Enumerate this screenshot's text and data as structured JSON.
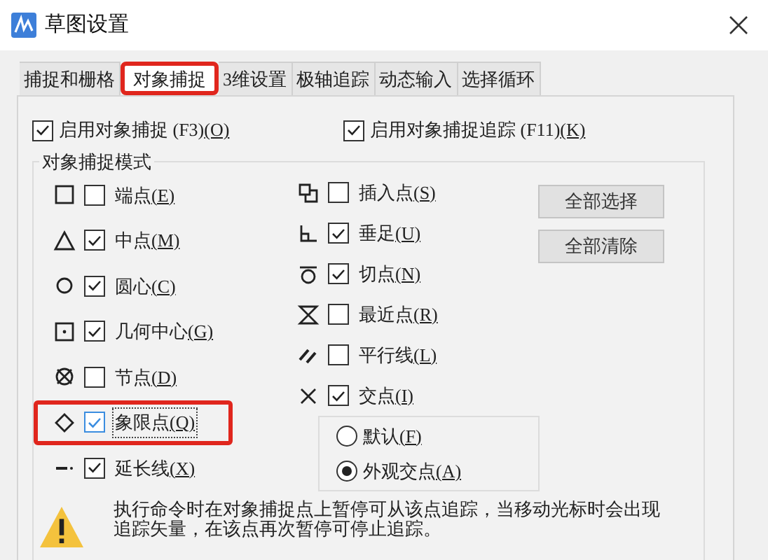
{
  "window": {
    "title": "草图设置"
  },
  "tabs": [
    {
      "label": "捕捉和栅格",
      "selected": false,
      "highlighted": false
    },
    {
      "label": "对象捕捉",
      "selected": true,
      "highlighted": true
    },
    {
      "label": "3维设置",
      "selected": false,
      "highlighted": false
    },
    {
      "label": "极轴追踪",
      "selected": false,
      "highlighted": false
    },
    {
      "label": "动态输入",
      "selected": false,
      "highlighted": false
    },
    {
      "label": "选择循环",
      "selected": false,
      "highlighted": false
    }
  ],
  "toggles": [
    {
      "label": "启用对象捕捉 (F3)",
      "key": "(O)",
      "checked": true
    },
    {
      "label": "启用对象捕捉追踪 (F11)",
      "key": "(K)",
      "checked": true
    }
  ],
  "group": {
    "title": "对象捕捉模式"
  },
  "modes_left": [
    {
      "label": "端点",
      "key": "(E)",
      "checked": false,
      "highlighted": false
    },
    {
      "label": "中点",
      "key": "(M)",
      "checked": true,
      "highlighted": false
    },
    {
      "label": "圆心",
      "key": "(C)",
      "checked": true,
      "highlighted": false
    },
    {
      "label": "几何中心",
      "key": "(G)",
      "checked": true,
      "highlighted": false
    },
    {
      "label": "节点",
      "key": "(D)",
      "checked": false,
      "highlighted": false
    },
    {
      "label": "象限点",
      "key": "(Q)",
      "checked": true,
      "highlighted": true
    },
    {
      "label": "延长线",
      "key": "(X)",
      "checked": true,
      "highlighted": false
    }
  ],
  "modes_right": [
    {
      "label": "插入点",
      "key": "(S)",
      "checked": false
    },
    {
      "label": "垂足",
      "key": "(U)",
      "checked": true
    },
    {
      "label": "切点",
      "key": "(N)",
      "checked": true
    },
    {
      "label": "最近点",
      "key": "(R)",
      "checked": false
    },
    {
      "label": "平行线",
      "key": "(L)",
      "checked": false
    },
    {
      "label": "交点",
      "key": "(I)",
      "checked": true
    }
  ],
  "intersection_options": [
    {
      "label": "默认",
      "key": "(F)",
      "selected": false
    },
    {
      "label": "外观交点",
      "key": "(A)",
      "selected": true
    }
  ],
  "buttons": [
    "全部选择",
    "全部清除"
  ],
  "hint": "执行命令时在对象捕捉点上暂停可从该点追踪，当移动光标时会出现追踪矢量，在该点再次暂停可停止追踪。"
}
